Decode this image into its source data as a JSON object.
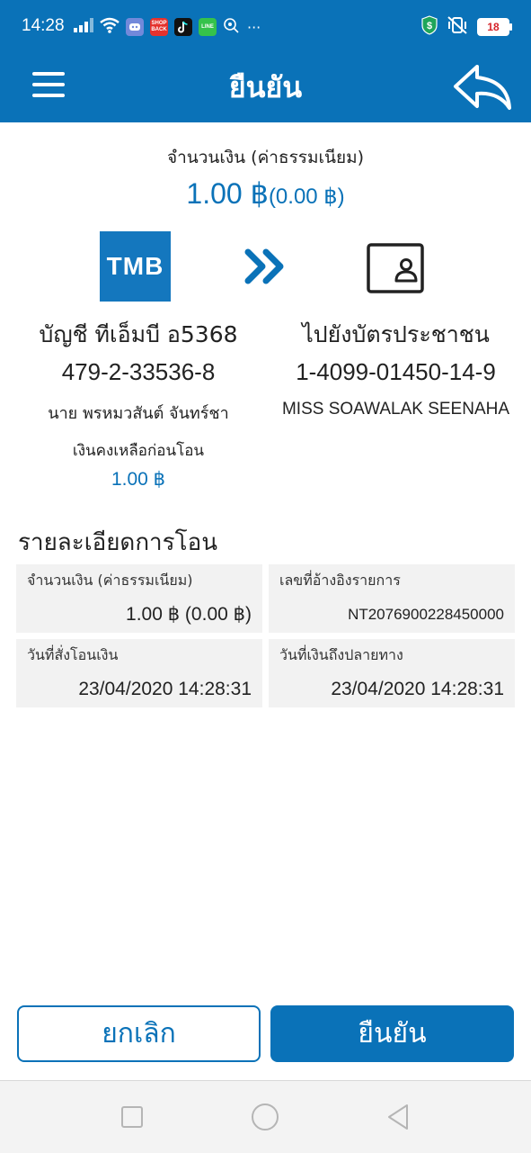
{
  "status_bar": {
    "time": "14:28",
    "app_icons": [
      {
        "name": "discord",
        "label": "",
        "color": "#7289da"
      },
      {
        "name": "shopback",
        "label": "SHOP BACK",
        "color": "#e5322d"
      },
      {
        "name": "tiktok",
        "label": "",
        "color": "#111111"
      },
      {
        "name": "line",
        "label": "LINE",
        "color": "#35c24b"
      }
    ],
    "more": "···",
    "battery": "18",
    "accent_shield": "#1fa55a"
  },
  "header": {
    "title": "ยืนยัน",
    "menu_icon": "hamburger-menu-icon",
    "back_icon": "reply-arrow-icon"
  },
  "transfer": {
    "amount_label": "จำนวนเงิน (ค่าธรรมเนียม)",
    "amount": "1.00 ฿",
    "fee": "(0.00 ฿)",
    "bank_logo": "TMB",
    "from": {
      "title": "บัญชี ทีเอ็มบี อ5368",
      "number": "479-2-33536-8",
      "name": "นาย พรหมวสันต์  จันทร์ชา"
    },
    "to": {
      "title": "ไปยังบัตรประชาชน",
      "number": "1-4099-01450-14-9",
      "name": "MISS SOAWALAK  SEENAHA"
    },
    "balance_label": "เงินคงเหลือก่อนโอน",
    "balance_value": "1.00 ฿"
  },
  "details": {
    "section_title": "รายละเอียดการโอน",
    "amount_label": "จำนวนเงิน (ค่าธรรมเนียม)",
    "amount_value": "1.00 ฿ (0.00 ฿)",
    "ref_label": "เลขที่อ้างอิงรายการ",
    "ref_value": "NT2076900228450000",
    "order_date_label": "วันที่สั่งโอนเงิน",
    "order_date_value": "23/04/2020 14:28:31",
    "arrive_date_label": "วันที่เงินถึงปลายทาง",
    "arrive_date_value": "23/04/2020 14:28:31"
  },
  "buttons": {
    "cancel": "ยกเลิก",
    "confirm": "ยืนยัน"
  },
  "colors": {
    "primary": "#0a72b8",
    "card_bg": "#f2f2f2"
  }
}
